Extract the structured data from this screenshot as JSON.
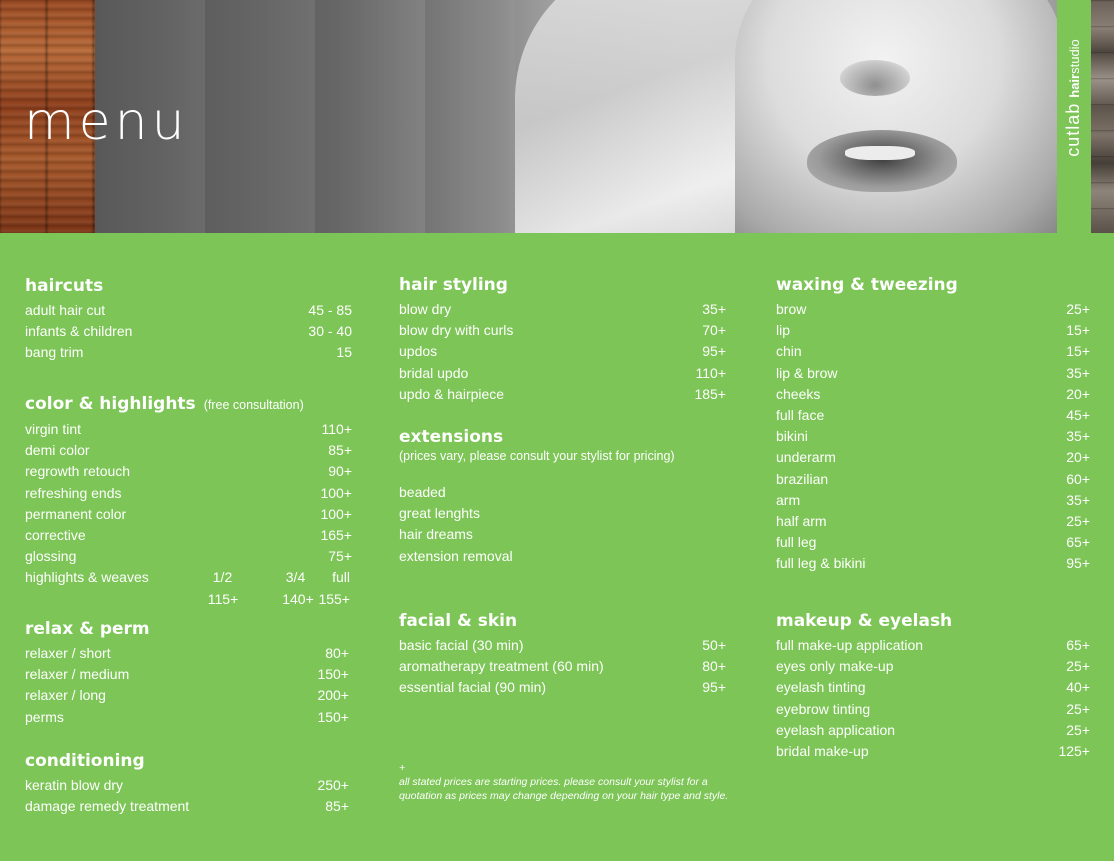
{
  "header": {
    "title": "menu",
    "brand_line1": "cutlab",
    "brand_line2_bold": "hair",
    "brand_line2_rest": "studio"
  },
  "haircuts": {
    "title": "haircuts",
    "items": [
      {
        "name": "adult hair cut",
        "price": "45 - 85"
      },
      {
        "name": "infants & children",
        "price": "30 - 40"
      },
      {
        "name": "bang trim",
        "price": "15"
      }
    ]
  },
  "color": {
    "title": "color & highlights",
    "note": "(free consultation)",
    "items": [
      {
        "name": "virgin tint",
        "price": "110+"
      },
      {
        "name": "demi color",
        "price": "85+"
      },
      {
        "name": "regrowth retouch",
        "price": "90+"
      },
      {
        "name": "refreshing ends",
        "price": "100+"
      },
      {
        "name": "permanent color",
        "price": "100+"
      },
      {
        "name": "corrective",
        "price": "165+"
      },
      {
        "name": "glossing",
        "price": "75+"
      }
    ],
    "highlights": {
      "name": "highlights & weaves",
      "labels": [
        "1/2",
        "3/4",
        "full"
      ],
      "prices": [
        "115+",
        "140+",
        "155+"
      ]
    }
  },
  "relax": {
    "title": "relax & perm",
    "items": [
      {
        "name": "relaxer  /  short",
        "price": "80+"
      },
      {
        "name": "relaxer  /  medium",
        "price": "150+"
      },
      {
        "name": "relaxer  /  long",
        "price": "200+"
      },
      {
        "name": "perms",
        "price": "150+"
      }
    ]
  },
  "conditioning": {
    "title": "conditioning",
    "items": [
      {
        "name": "keratin blow dry",
        "price": "250+"
      },
      {
        "name": "damage remedy treatment",
        "price": "85+"
      }
    ]
  },
  "styling": {
    "title": "hair styling",
    "items": [
      {
        "name": "blow dry",
        "price": "35+"
      },
      {
        "name": "blow dry with curls",
        "price": "70+"
      },
      {
        "name": "updos",
        "price": "95+"
      },
      {
        "name": "bridal updo",
        "price": "110+"
      },
      {
        "name": "updo & hairpiece",
        "price": "185+"
      }
    ]
  },
  "extensions": {
    "title": "extensions",
    "note": "(prices vary, please consult your stylist for pricing)",
    "items": [
      "beaded",
      "great lenghts",
      "hair dreams",
      "extension removal"
    ]
  },
  "facial": {
    "title": "facial & skin",
    "items": [
      {
        "name": "basic facial (30 min)",
        "price": "50+"
      },
      {
        "name": "aromatherapy treatment (60 min)",
        "price": "80+"
      },
      {
        "name": "essential facial (90 min)",
        "price": "95+"
      }
    ]
  },
  "footnote": {
    "mark": "+",
    "text": "all stated prices are starting prices. please consult your stylist for a quotation as prices may change depending on your hair type and style."
  },
  "waxing": {
    "title": "waxing & tweezing",
    "items": [
      {
        "name": "brow",
        "price": "25+"
      },
      {
        "name": "lip",
        "price": "15+"
      },
      {
        "name": "chin",
        "price": "15+"
      },
      {
        "name": "lip & brow",
        "price": "35+"
      },
      {
        "name": "cheeks",
        "price": "20+"
      },
      {
        "name": "full face",
        "price": "45+"
      },
      {
        "name": "bikini",
        "price": "35+"
      },
      {
        "name": "underarm",
        "price": "20+"
      },
      {
        "name": "brazilian",
        "price": "60+"
      },
      {
        "name": "arm",
        "price": "35+"
      },
      {
        "name": "half arm",
        "price": "25+"
      },
      {
        "name": "full leg",
        "price": "65+"
      },
      {
        "name": "full leg & bikini",
        "price": "95+"
      }
    ]
  },
  "makeup": {
    "title": "makeup & eyelash",
    "items": [
      {
        "name": "full make-up application",
        "price": "65+"
      },
      {
        "name": "eyes only make-up",
        "price": "25+"
      },
      {
        "name": "eyelash tinting",
        "price": "40+"
      },
      {
        "name": "eyebrow tinting",
        "price": "25+"
      },
      {
        "name": "eyelash application",
        "price": "25+"
      },
      {
        "name": "bridal make-up",
        "price": "125+"
      }
    ]
  },
  "colors": {
    "background": "#7cc556",
    "text": "#ffffff"
  }
}
